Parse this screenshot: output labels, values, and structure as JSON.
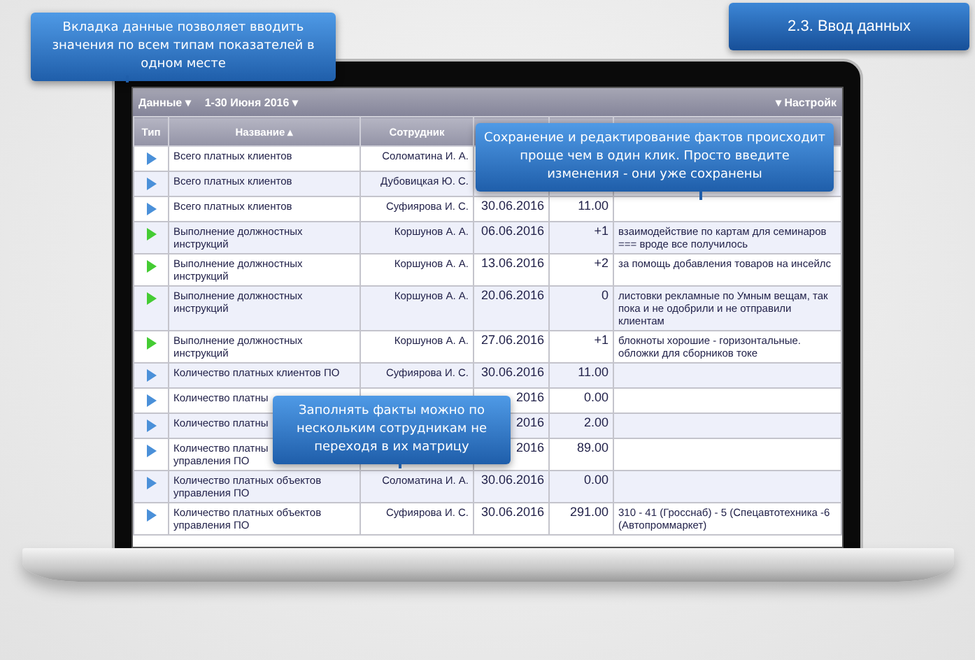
{
  "title_badge": "2.3. Ввод данных",
  "callouts": [
    {
      "text": "Вкладка данные позволяет вводить значения по всем типам показателей в одном месте"
    },
    {
      "text": "Сохранение и редактирование фактов происходит проще чем в один клик. Просто введите изменения - они уже сохранены"
    },
    {
      "text": "Заполнять факты можно по нескольким сотрудникам не переходя в их матрицу"
    }
  ],
  "toolbar": {
    "tab": "Данные ▾",
    "period": "1-30 Июня 2016 ▾",
    "settings": "▾ Настройк"
  },
  "table": {
    "columns": [
      "Тип",
      "Название ▴",
      "Сотрудник"
    ],
    "rows": [
      {
        "color": "#4a90d9",
        "name": "Всего платных клиентов",
        "employee": "Соломатина И. А."
      },
      {
        "color": "#4a90d9",
        "name": "Всего платных клиентов",
        "employee": "Дубовицкая Ю. С."
      },
      {
        "color": "#4a90d9",
        "name": "Всего платных клиентов",
        "employee": "Суфиярова И. С.",
        "date": "30.06.2016",
        "value": "11.00"
      },
      {
        "color": "#44cc33",
        "name": "Выполнение должностных инструкций",
        "employee": "Коршунов А. А.",
        "date": "06.06.2016",
        "value": "+1",
        "comment": "взаимодействие по картам для семинаров === вроде все получилось"
      },
      {
        "color": "#44cc33",
        "name": "Выполнение должностных инструкций",
        "employee": "Коршунов А. А.",
        "date": "13.06.2016",
        "value": "+2",
        "comment": "за помощь добавления товаров на инсейлс"
      },
      {
        "color": "#44cc33",
        "name": "Выполнение должностных инструкций",
        "employee": "Коршунов А. А.",
        "date": "20.06.2016",
        "value": "0",
        "comment": "листовки рекламные по Умным вещам, так пока и не одобрили и не отправили клиентам"
      },
      {
        "color": "#44cc33",
        "name": "Выполнение должностных инструкций",
        "employee": "Коршунов А. А.",
        "date": "27.06.2016",
        "value": "+1",
        "comment": "блокноты хорошие - горизонтальные. обложки для сборников токе"
      },
      {
        "color": "#4a90d9",
        "name": "Количество платных клиентов ПО",
        "employee": "Суфиярова И. С.",
        "date": "30.06.2016",
        "value": "11.00"
      },
      {
        "color": "#4a90d9",
        "name": "Количество платны",
        "date": "2016",
        "value": "0.00"
      },
      {
        "color": "#4a90d9",
        "name": "Количество платны",
        "date": "2016",
        "value": "2.00"
      },
      {
        "color": "#4a90d9",
        "name": "Количество платны\nуправления ПО",
        "date": "2016",
        "value": "89.00"
      },
      {
        "color": "#4a90d9",
        "name": "Количество платных объектов управления ПО",
        "employee": "Соломатина И. А.",
        "date": "30.06.2016",
        "value": "0.00"
      },
      {
        "color": "#4a90d9",
        "name": "Количество платных объектов управления ПО",
        "employee": "Суфиярова И. С.",
        "date": "30.06.2016",
        "value": "291.00",
        "comment": "310 - 41 (Гросснаб) - 5 (Спецавтотехника -6 (Автопроммаркет)"
      }
    ]
  }
}
